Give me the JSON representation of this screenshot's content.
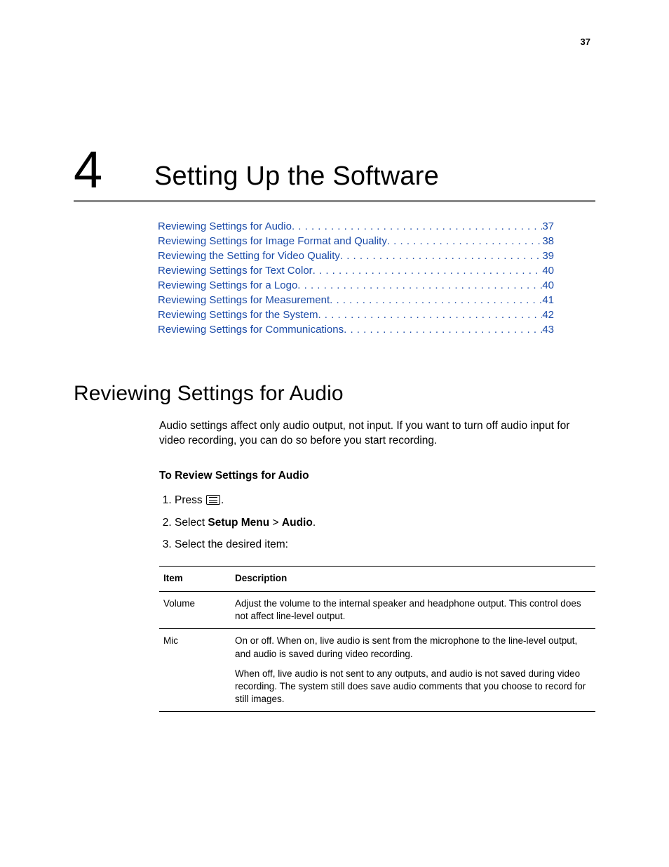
{
  "page_number": "37",
  "chapter": {
    "number": "4",
    "title": "Setting Up the Software"
  },
  "toc": [
    {
      "label": "Reviewing Settings for Audio",
      "page": "37"
    },
    {
      "label": "Reviewing Settings for Image Format and Quality",
      "page": "38"
    },
    {
      "label": "Reviewing the Setting for Video Quality",
      "page": "39"
    },
    {
      "label": "Reviewing Settings for Text Color",
      "page": "40"
    },
    {
      "label": "Reviewing Settings for a Logo",
      "page": "40"
    },
    {
      "label": "Reviewing Settings for Measurement",
      "page": "41"
    },
    {
      "label": "Reviewing Settings for the System",
      "page": "42"
    },
    {
      "label": "Reviewing Settings for Communications",
      "page": "43"
    }
  ],
  "section": {
    "title": "Reviewing Settings for Audio",
    "intro": "Audio settings affect only audio output, not input. If you want to turn off audio input for video recording, you can do so before you start recording.",
    "subhead": "To Review Settings for Audio",
    "steps": {
      "s1_a": "Press ",
      "s1_b": ".",
      "s2_a": "Select ",
      "s2_b": "Setup Menu",
      "s2_c": " > ",
      "s2_d": "Audio",
      "s2_e": ".",
      "s3": "Select the desired item:"
    },
    "table": {
      "headers": {
        "item": "Item",
        "desc": "Description"
      },
      "rows": [
        {
          "item": "Volume",
          "desc": [
            "Adjust the volume to the internal speaker and headphone output. This control does not affect line-level output."
          ]
        },
        {
          "item": "Mic",
          "desc": [
            "On or off. When on, live audio is sent from the microphone to the line-level output, and audio is saved during video recording.",
            "When off, live audio is not sent to any outputs, and audio is not saved during video recording. The system still does save audio comments that you choose to record for still images."
          ]
        }
      ]
    }
  }
}
